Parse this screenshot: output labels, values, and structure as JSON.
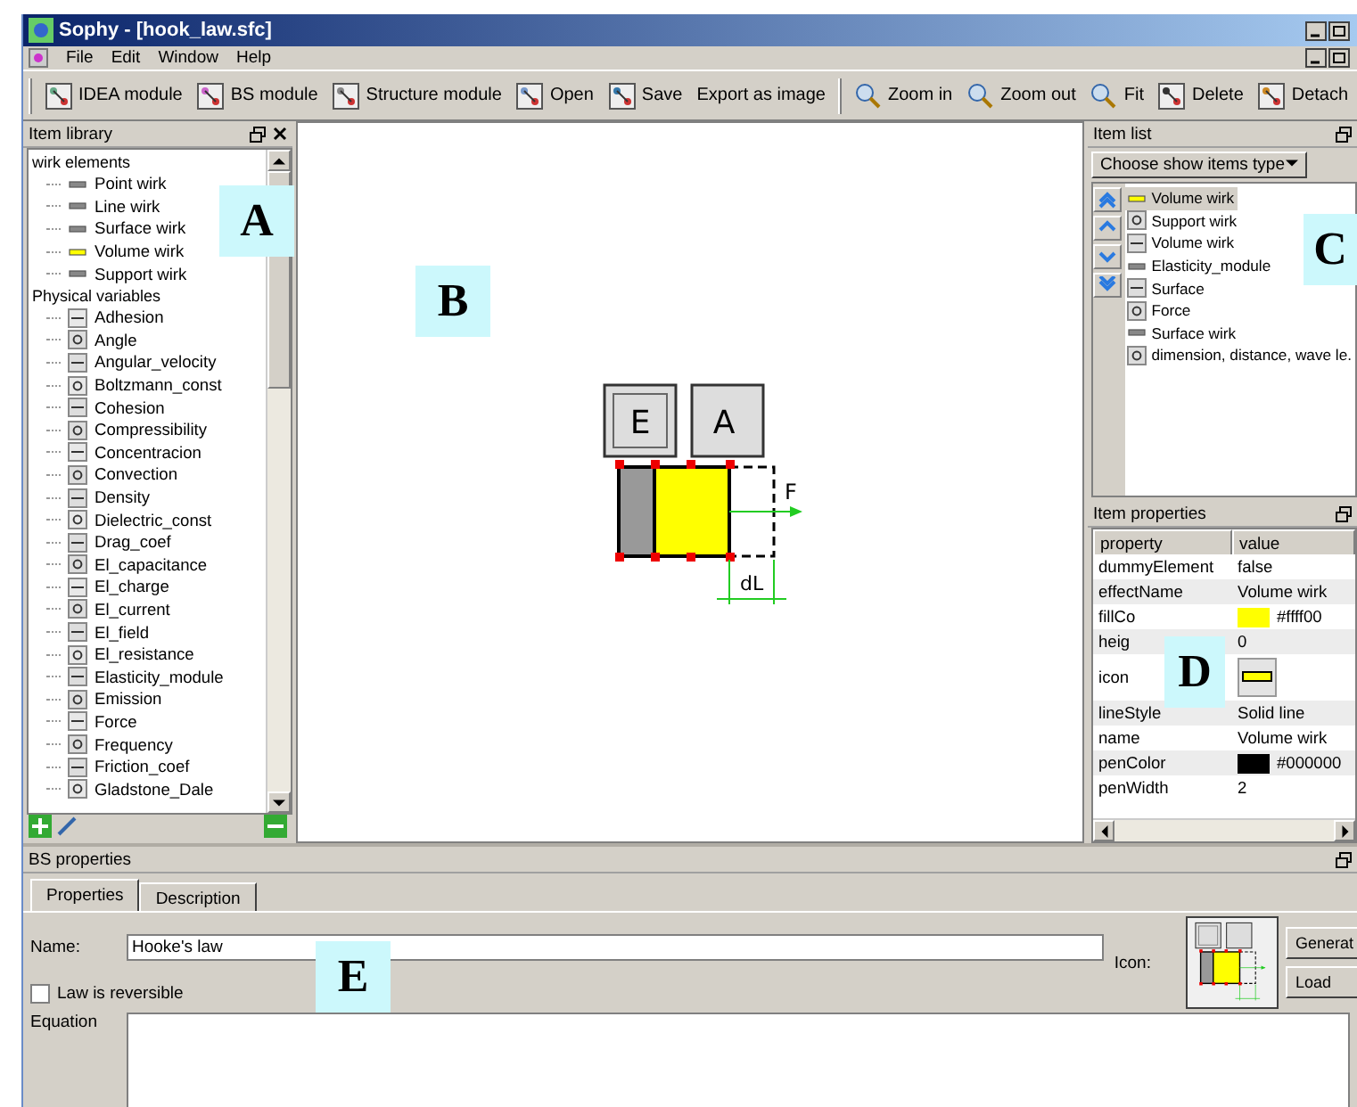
{
  "window": {
    "title": "Sophy - [hook_law.sfc]"
  },
  "menu": [
    "File",
    "Edit",
    "Window",
    "Help"
  ],
  "toolbar_groups": [
    [
      "IDEA module",
      "BS module",
      "Structure module",
      "Open",
      "Save",
      "Export as image"
    ],
    [
      "Zoom in",
      "Zoom out",
      "Fit",
      "Delete",
      "Detach"
    ]
  ],
  "item_library": {
    "title": "Item library",
    "callout": "A",
    "sections": [
      {
        "label": "wirk elements",
        "children": [
          {
            "label": "Point wirk"
          },
          {
            "label": "Line wirk"
          },
          {
            "label": "Surface wirk"
          },
          {
            "label": "Volume wirk"
          },
          {
            "label": "Support wirk"
          }
        ]
      },
      {
        "label": "Physical variables",
        "children": [
          {
            "label": "Adhesion"
          },
          {
            "label": "Angle"
          },
          {
            "label": "Angular_velocity"
          },
          {
            "label": "Boltzmann_const"
          },
          {
            "label": "Cohesion"
          },
          {
            "label": "Compressibility"
          },
          {
            "label": "Concentracion"
          },
          {
            "label": "Convection"
          },
          {
            "label": "Density"
          },
          {
            "label": "Dielectric_const"
          },
          {
            "label": "Drag_coef"
          },
          {
            "label": "El_capacitance"
          },
          {
            "label": "El_charge"
          },
          {
            "label": "El_current"
          },
          {
            "label": "El_field"
          },
          {
            "label": "El_resistance"
          },
          {
            "label": "Elasticity_module"
          },
          {
            "label": "Emission"
          },
          {
            "label": "Force"
          },
          {
            "label": "Frequency"
          },
          {
            "label": "Friction_coef"
          },
          {
            "label": "Gladstone_Dale"
          }
        ]
      }
    ]
  },
  "canvas": {
    "callout": "B",
    "labels": [
      "E",
      "A",
      "F",
      "dL"
    ]
  },
  "item_list": {
    "title": "Item list",
    "callout": "C",
    "filter_button": "Choose show items type",
    "items": [
      {
        "label": "Volume wirk",
        "selected": true
      },
      {
        "label": "Support wirk",
        "selected": false
      },
      {
        "label": "Volume wirk",
        "selected": false
      },
      {
        "label": "Elasticity_module",
        "selected": false
      },
      {
        "label": "Surface",
        "selected": false
      },
      {
        "label": "Force",
        "selected": false
      },
      {
        "label": "Surface wirk",
        "selected": false
      },
      {
        "label": "dimension, distance, wave le.",
        "selected": false
      }
    ]
  },
  "item_properties": {
    "title": "Item properties",
    "callout": "D",
    "columns": [
      "property",
      "value"
    ],
    "rows": [
      {
        "property": "dummyElement",
        "value": "false",
        "kind": "text"
      },
      {
        "property": "effectName",
        "value": "Volume wirk",
        "kind": "text"
      },
      {
        "property": "fillCo",
        "value": "#ffff00",
        "kind": "color",
        "color": "#ffff00"
      },
      {
        "property": "heig",
        "value": "0",
        "kind": "text"
      },
      {
        "property": "icon",
        "kind": "icon"
      },
      {
        "property": "lineStyle",
        "value": "Solid line",
        "kind": "text"
      },
      {
        "property": "name",
        "value": "Volume wirk",
        "kind": "text"
      },
      {
        "property": "penColor",
        "value": "#000000",
        "kind": "color",
        "color": "#000000"
      },
      {
        "property": "penWidth",
        "value": "2",
        "kind": "text"
      }
    ]
  },
  "bs_properties": {
    "title": "BS properties",
    "callout": "E",
    "tabs": [
      {
        "label": "Properties",
        "selected": true
      },
      {
        "label": "Description",
        "selected": false
      }
    ],
    "name_label": "Name:",
    "name_value": "Hooke's law",
    "reversible": {
      "label": "Law is reversible",
      "checked": false
    },
    "icon_label": "Icon:",
    "equation_label": "Equation",
    "buttons": [
      "Generat",
      "Load"
    ]
  }
}
